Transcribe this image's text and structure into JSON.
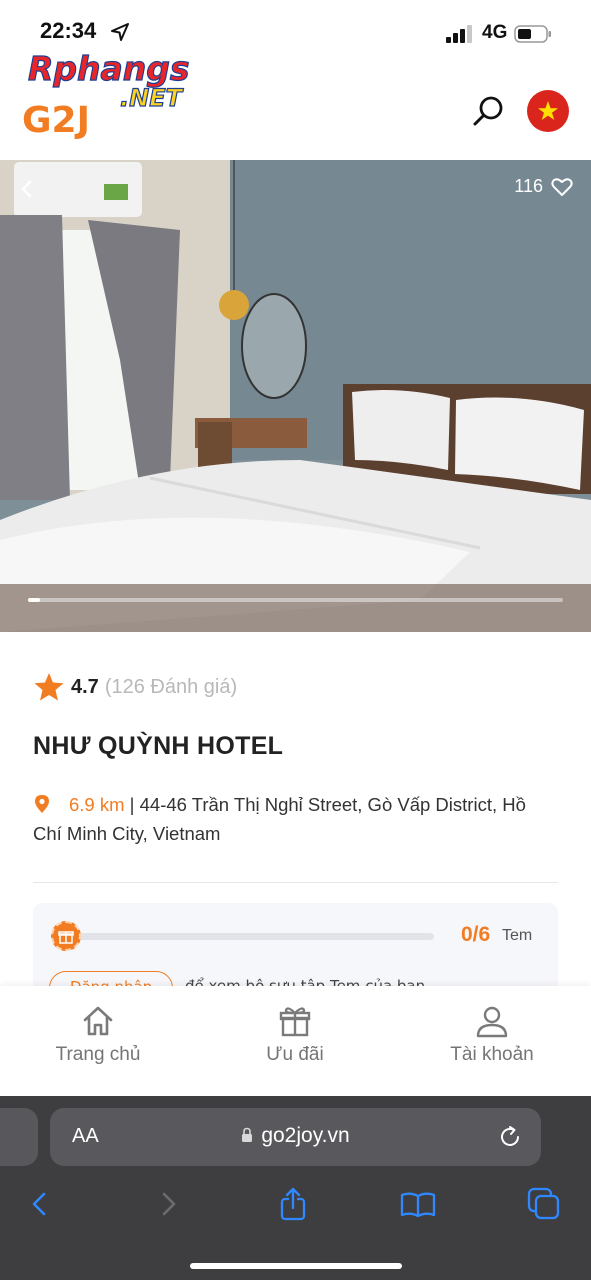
{
  "status_bar": {
    "time": "22:34",
    "network": "4G"
  },
  "header": {
    "logo_text_top": "Rphangs",
    "logo_text_net": ".NET",
    "logo_text_g2j": "G2J",
    "colors": {
      "brand": "#f27c22",
      "flag": "#da251d"
    }
  },
  "hero": {
    "likes": "116",
    "slide_progress": 0.02
  },
  "hotel": {
    "rating": "4.7",
    "reviews": "(126 Đánh giá)",
    "name": "NHƯ QUỲNH HOTEL",
    "distance": "6.9 km",
    "address": " | 44-46 Trần Thị Nghỉ Street, Gò Vấp District, Hồ Chí Minh City, Vietnam"
  },
  "stamps": {
    "count": "0/6",
    "unit": "Tem",
    "progress": 0,
    "login_label": "Đăng nhập",
    "login_hint": "để xem bộ sưu tập Tem của bạn"
  },
  "tabs": [
    {
      "label": "Trang chủ",
      "icon": "home-icon"
    },
    {
      "label": "Ưu đãi",
      "icon": "gift-icon"
    },
    {
      "label": "Tài khoản",
      "icon": "user-icon"
    }
  ],
  "browser": {
    "text_size": "AA",
    "url": "go2joy.vn"
  }
}
